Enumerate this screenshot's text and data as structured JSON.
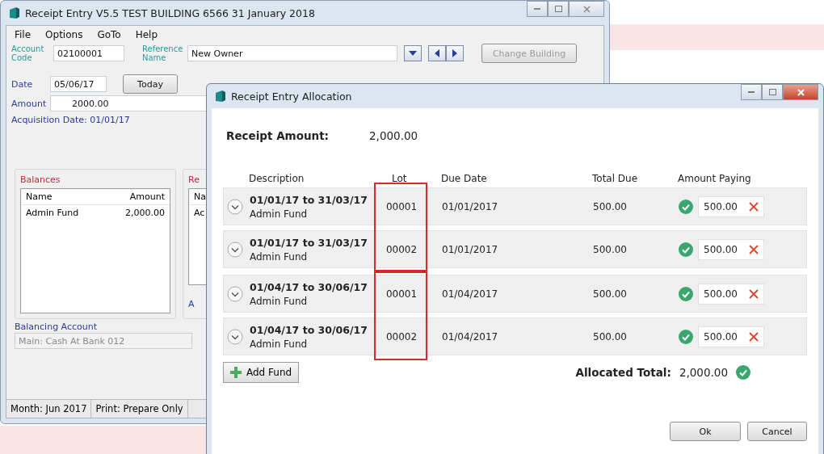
{
  "main_window": {
    "title": "Receipt Entry V5.5 TEST BUILDING 6566 31 January 2018",
    "menu": [
      "File",
      "Options",
      "GoTo",
      "Help"
    ],
    "account_code": {
      "label": "Account Code",
      "value": "02100001"
    },
    "reference_name": {
      "label": "Reference Name",
      "value": "New Owner"
    },
    "change_building": {
      "label": "Change Building",
      "disabled": true
    },
    "date": {
      "label": "Date",
      "value": "05/06/17"
    },
    "today_button": "Today",
    "amount": {
      "label": "Amount",
      "value": "2000.00"
    },
    "acquisition": "Acquisition Date: 01/01/17",
    "balances": {
      "title": "Balances",
      "columns": [
        "Name",
        "Amount"
      ],
      "rows": [
        [
          "Admin Fund",
          "2,000.00"
        ]
      ]
    },
    "second_group": {
      "title": "Re",
      "column": "Na",
      "row": "Ac",
      "footer": "A"
    },
    "balancing_account": {
      "label": "Balancing Account",
      "value": "Main: Cash At Bank 012",
      "disabled": true
    },
    "status_bar": [
      "Month: Jun 2017",
      "Print: Prepare Only"
    ]
  },
  "dialog": {
    "title": "Receipt Entry Allocation",
    "receipt_amount": {
      "label": "Receipt Amount:",
      "value": "2,000.00"
    },
    "columns": [
      "Description",
      "Lot",
      "Due Date",
      "Total Due",
      "Amount Paying"
    ],
    "groups": [
      {
        "highlighted": true,
        "rows": [
          {
            "period": "01/01/17 to 31/03/17",
            "fund": "Admin Fund",
            "lot": "00001",
            "due_date": "01/01/2017",
            "total_due": "500.00",
            "paying": "500.00"
          },
          {
            "period": "01/01/17 to 31/03/17",
            "fund": "Admin Fund",
            "lot": "00002",
            "due_date": "01/01/2017",
            "total_due": "500.00",
            "paying": "500.00"
          }
        ]
      },
      {
        "highlighted": true,
        "rows": [
          {
            "period": "01/04/17 to 30/06/17",
            "fund": "Admin Fund",
            "lot": "00001",
            "due_date": "01/04/2017",
            "total_due": "500.00",
            "paying": "500.00"
          },
          {
            "period": "01/04/17 to 30/06/17",
            "fund": "Admin Fund",
            "lot": "00002",
            "due_date": "01/04/2017",
            "total_due": "500.00",
            "paying": "500.00"
          }
        ]
      }
    ],
    "add_fund": "Add Fund",
    "allocated_total": {
      "label": "Allocated Total:",
      "value": "2,000.00"
    },
    "buttons": [
      "Ok",
      "Cancel"
    ]
  }
}
